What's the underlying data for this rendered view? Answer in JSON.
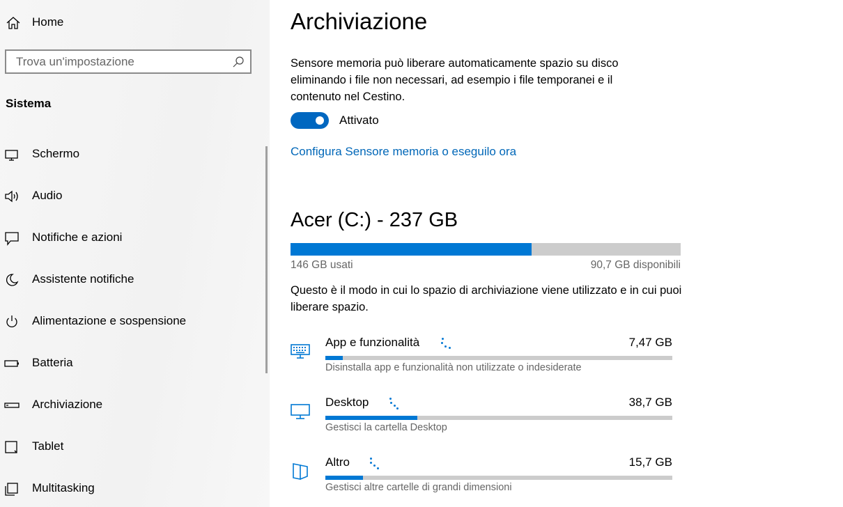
{
  "sidebar": {
    "home_label": "Home",
    "search_placeholder": "Trova un'impostazione",
    "section_title": "Sistema",
    "items": [
      {
        "label": "Schermo",
        "icon": "monitor-icon"
      },
      {
        "label": "Audio",
        "icon": "speaker-icon"
      },
      {
        "label": "Notifiche e azioni",
        "icon": "notification-icon"
      },
      {
        "label": "Assistente notifiche",
        "icon": "moon-icon"
      },
      {
        "label": "Alimentazione e sospensione",
        "icon": "power-icon"
      },
      {
        "label": "Batteria",
        "icon": "battery-icon"
      },
      {
        "label": "Archiviazione",
        "icon": "storage-icon"
      },
      {
        "label": "Tablet",
        "icon": "tablet-icon"
      },
      {
        "label": "Multitasking",
        "icon": "multitasking-icon"
      }
    ]
  },
  "main": {
    "title": "Archiviazione",
    "description": "Sensore memoria può liberare automaticamente spazio su disco eliminando i file non necessari, ad esempio i file temporanei e il contenuto nel Cestino.",
    "toggle_state": "Attivato",
    "config_link": "Configura Sensore memoria o eseguilo ora",
    "drive": {
      "title": "Acer (C:) - 237 GB",
      "used_fraction": 0.617,
      "used_label": "146 GB usati",
      "free_label": "90,7 GB disponibili"
    },
    "usage_description": "Questo è il modo in cui lo spazio di archiviazione viene utilizzato e in cui puoi liberare spazio.",
    "categories": [
      {
        "name": "App e funzionalità",
        "size": "7,47 GB",
        "subtitle": "Disinstalla app e funzionalità non utilizzate o indesiderate",
        "fraction": 0.05,
        "icon": "keyboard-icon"
      },
      {
        "name": "Desktop",
        "size": "38,7 GB",
        "subtitle": "Gestisci la cartella Desktop",
        "fraction": 0.265,
        "icon": "desktop-icon"
      },
      {
        "name": "Altro",
        "size": "15,7 GB",
        "subtitle": "Gestisci altre cartelle di grandi dimensioni",
        "fraction": 0.108,
        "icon": "folder-icon"
      }
    ]
  },
  "colors": {
    "accent": "#0078d4",
    "link": "#0067b8",
    "bar_track": "#cccccc"
  }
}
